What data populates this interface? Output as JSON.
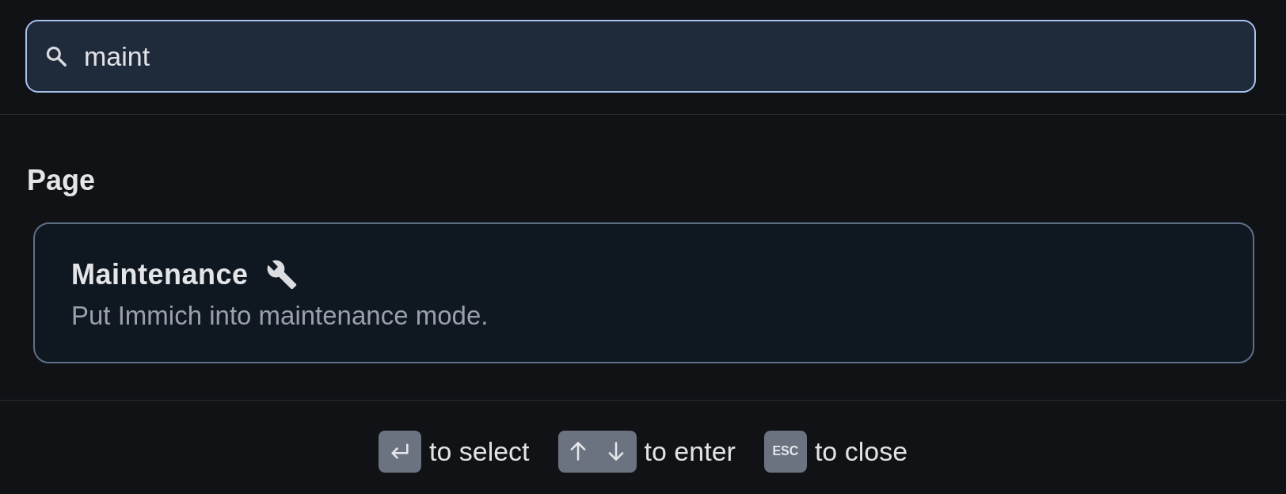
{
  "search": {
    "value": "maint"
  },
  "sections": [
    {
      "title": "Page",
      "items": [
        {
          "title": "Maintenance",
          "description": "Put Immich into maintenance mode.",
          "selected": true
        }
      ]
    }
  ],
  "hints": [
    {
      "kind": "enter",
      "label": "to select"
    },
    {
      "kind": "arrows",
      "label": "to enter"
    },
    {
      "kind": "esc",
      "key": "ESC",
      "label": "to close"
    }
  ]
}
